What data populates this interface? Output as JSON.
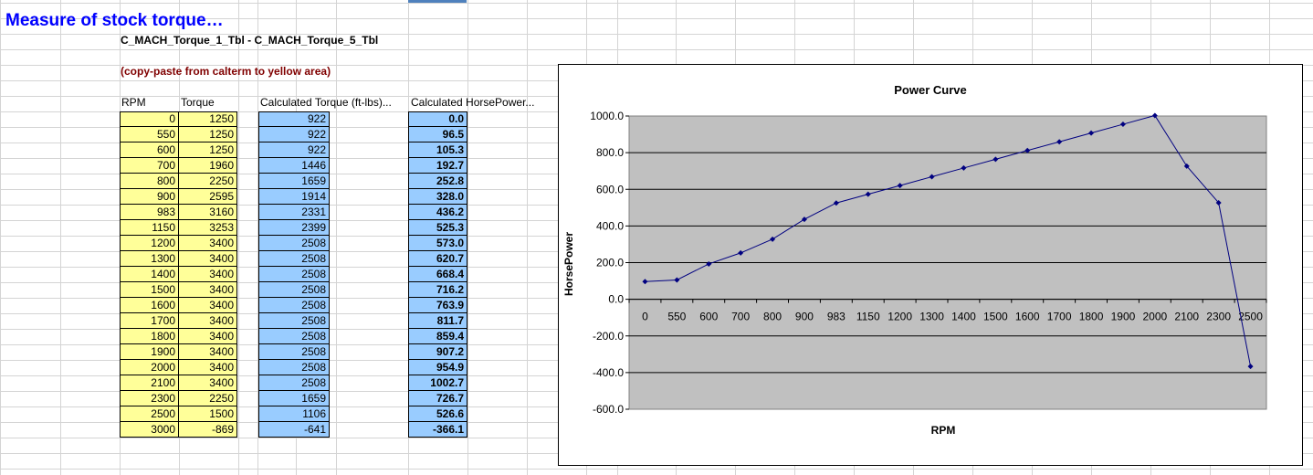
{
  "sheet": {
    "title": "Measure of stock torque…",
    "subtitle": "C_MACH_Torque_1_Tbl - C_MACH_Torque_5_Tbl",
    "note": "(copy-paste from calterm to yellow area)",
    "headers": {
      "rpm": "RPM",
      "torque": "Torque",
      "calc_torque": "Calculated Torque (ft-lbs)...",
      "calc_hp": "Calculated HorsePower..."
    },
    "rpm": [
      "0",
      "550",
      "600",
      "700",
      "800",
      "900",
      "983",
      "1150",
      "1200",
      "1300",
      "1400",
      "1500",
      "1600",
      "1700",
      "1800",
      "1900",
      "2000",
      "2100",
      "2300",
      "2500",
      "3000"
    ],
    "torque": [
      "1250",
      "1250",
      "1250",
      "1960",
      "2250",
      "2595",
      "3160",
      "3253",
      "3400",
      "3400",
      "3400",
      "3400",
      "3400",
      "3400",
      "3400",
      "3400",
      "3400",
      "3400",
      "2250",
      "1500",
      "-869"
    ],
    "calc_torque": [
      "922",
      "922",
      "922",
      "1446",
      "1659",
      "1914",
      "2331",
      "2399",
      "2508",
      "2508",
      "2508",
      "2508",
      "2508",
      "2508",
      "2508",
      "2508",
      "2508",
      "2508",
      "1659",
      "1106",
      "-641"
    ],
    "calc_hp": [
      "0.0",
      "96.5",
      "105.3",
      "192.7",
      "252.8",
      "328.0",
      "436.2",
      "525.3",
      "573.0",
      "620.7",
      "668.4",
      "716.2",
      "763.9",
      "811.7",
      "859.4",
      "907.2",
      "954.9",
      "1002.7",
      "726.7",
      "526.6",
      "-366.1"
    ]
  },
  "chart_data": {
    "type": "line",
    "title": "Power Curve",
    "xlabel": "RPM",
    "ylabel": "HorsePower",
    "categories": [
      "0",
      "550",
      "600",
      "700",
      "800",
      "900",
      "983",
      "1150",
      "1200",
      "1300",
      "1400",
      "1500",
      "1600",
      "1700",
      "1800",
      "1900",
      "2000",
      "2100",
      "2300",
      "2500"
    ],
    "values": [
      96.5,
      105.3,
      192.7,
      252.8,
      328.0,
      436.2,
      525.3,
      573.0,
      620.7,
      668.4,
      716.2,
      763.9,
      811.7,
      859.4,
      907.2,
      954.9,
      1002.7,
      726.7,
      526.6,
      -366.1
    ],
    "yticks": [
      "1000.0",
      "800.0",
      "600.0",
      "400.0",
      "200.0",
      "0.0",
      "-200.0",
      "-400.0",
      "-600.0"
    ],
    "ylim": [
      -600,
      1000
    ],
    "grid": true,
    "legend": "none",
    "colors": {
      "plot_bg": "#c0c0c0",
      "line": "#000080"
    }
  }
}
